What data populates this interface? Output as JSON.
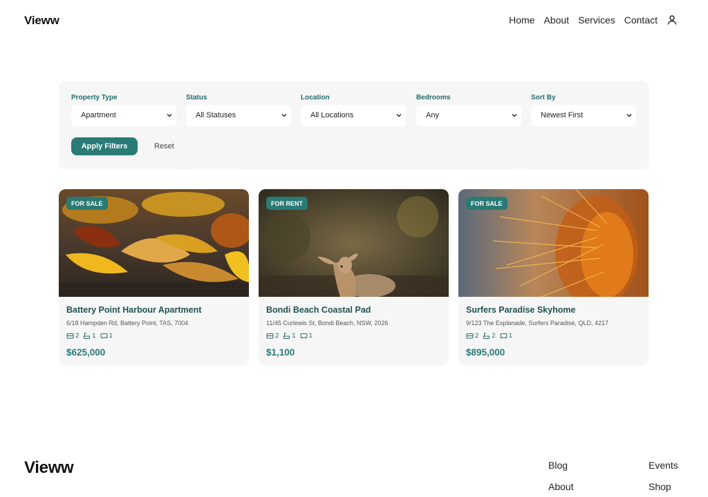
{
  "header": {
    "logo": "Vieww",
    "nav": [
      "Home",
      "About",
      "Services",
      "Contact"
    ],
    "user_icon": "user-icon"
  },
  "filters": {
    "groups": [
      {
        "label": "Property Type",
        "value": "Apartment"
      },
      {
        "label": "Status",
        "value": "All Statuses"
      },
      {
        "label": "Location",
        "value": "All Locations"
      },
      {
        "label": "Bedrooms",
        "value": "Any"
      },
      {
        "label": "Sort By",
        "value": "Newest First"
      }
    ],
    "apply_label": "Apply Filters",
    "reset_label": "Reset"
  },
  "listings": [
    {
      "badge": "FOR SALE",
      "title": "Battery Point Harbour Apartment",
      "address": "6/18 Hampden Rd, Battery Point, TAS, 7004",
      "beds": "2",
      "baths": "1",
      "cars": "1",
      "price": "$625,000",
      "image": "autumn-leaves-photo"
    },
    {
      "badge": "FOR RENT",
      "title": "Bondi Beach Coastal Pad",
      "address": "11/45 Curlewis St, Bondi Beach, NSW, 2026",
      "beds": "2",
      "baths": "1",
      "cars": "1",
      "price": "$1,100",
      "image": "deer-photo"
    },
    {
      "badge": "FOR SALE",
      "title": "Surfers Paradise Skyhome",
      "address": "9/123 The Esplanade, Surfers Paradise, QLD, 4217",
      "beds": "2",
      "baths": "2",
      "cars": "1",
      "price": "$895,000",
      "image": "cactus-photo"
    }
  ],
  "footer": {
    "logo": "Vieww",
    "links": [
      "Blog",
      "Events",
      "About",
      "Shop"
    ]
  },
  "colors": {
    "accent": "#2a7a75",
    "title": "#1e5353",
    "panel": "#f6f6f6"
  }
}
